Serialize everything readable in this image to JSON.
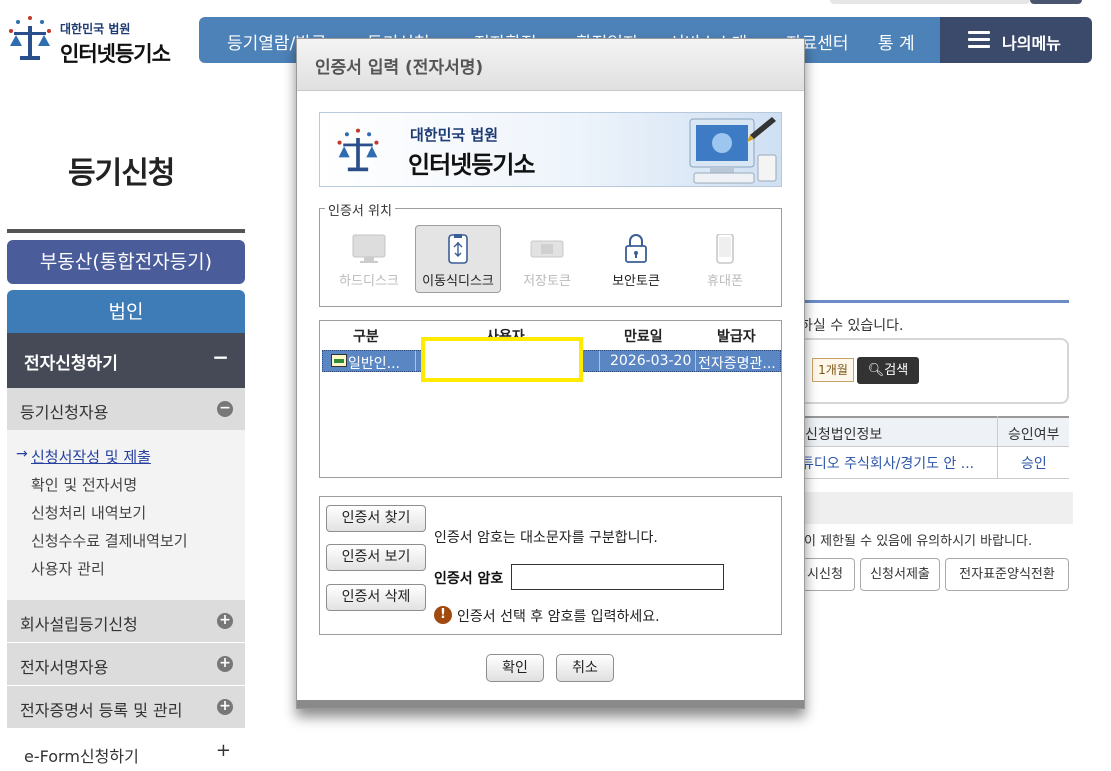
{
  "site": {
    "logo_small": "대한민국 법원",
    "logo_big": "인터넷등기소"
  },
  "gnb": {
    "items": [
      "등기열람/발급",
      "등기신청",
      "전자확정",
      "확정일자",
      "서비스소개",
      "자료센터",
      "통 계"
    ],
    "mymenu": "나의메뉴",
    "colors": {
      "bar": "#4d82b8",
      "mymenu": "#3b4a6b"
    }
  },
  "sidebar": {
    "page_title": "등기신청",
    "realty": "부동산(통합전자등기)",
    "corp": "법인",
    "active_section": "전자신청하기",
    "active_mark": "−",
    "groups": [
      {
        "label": "등기신청자용",
        "mark": "−"
      },
      {
        "label": "회사설립등기신청",
        "mark": "+"
      },
      {
        "label": "전자서명자용",
        "mark": "+"
      },
      {
        "label": "전자증명서 등록 및 관리",
        "mark": "+"
      }
    ],
    "links": [
      "신청서작성 및 제출",
      "확인 및 전자서명",
      "신청처리 내역보기",
      "신청수수료 결제내역보기",
      "사용자 관리"
    ],
    "eform": "e-Form신청하기",
    "eform_mark": "+"
  },
  "background": {
    "notice": "하실 수 있습니다.",
    "month_btn": "1개월",
    "search_btn": "검색",
    "table_headers": [
      "신청법인정보",
      "승인여부"
    ],
    "table_row": [
      "튜디오 주식회사/경기도 안 ...",
      "승인"
    ],
    "caution": "이 제한될 수 있음에 유의하시기 바랍니다.",
    "buttons": [
      "시신청",
      "신청서제출",
      "전자표준양식전환"
    ]
  },
  "dialog": {
    "title": "인증서 입력 (전자서명)",
    "banner_small": "대한민국 법원",
    "banner_big": "인터넷등기소",
    "location_legend": "인증서 위치",
    "locations": [
      {
        "label": "하드디스크",
        "icon": "monitor-icon",
        "state": "disabled"
      },
      {
        "label": "이동식디스크",
        "icon": "usb-icon",
        "state": "selected"
      },
      {
        "label": "저장토큰",
        "icon": "token-icon",
        "state": "disabled"
      },
      {
        "label": "보안토큰",
        "icon": "lock-icon",
        "state": "enabled"
      },
      {
        "label": "휴대폰",
        "icon": "phone-icon",
        "state": "disabled"
      }
    ],
    "table_headers": [
      "구분",
      "사용자",
      "만료일",
      "발급자"
    ],
    "cert_row": {
      "type": "일반인...",
      "user": "",
      "expiry": "2026-03-20",
      "issuer": "전자증명관..."
    },
    "buttons": {
      "find": "인증서 찾기",
      "view": "인증서 보기",
      "delete": "인증서 삭제",
      "ok": "확인",
      "cancel": "취소"
    },
    "case_note": "인증서 암호는 대소문자를 구분합니다.",
    "password_label": "인증서 암호",
    "password_value": "",
    "warning": "인증서 선택 후 암호를 입력하세요.",
    "colors": {
      "selected_row": "#5b86c4",
      "highlight": "#ffea00"
    }
  }
}
